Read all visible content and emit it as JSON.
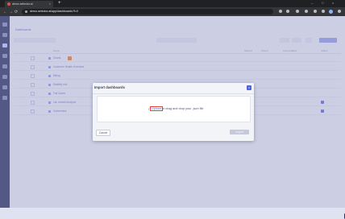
{
  "browser": {
    "tab_title": "demo.selector.ai",
    "url": "demo.selector.ai/app/dashboards?f=0",
    "new_tab_symbol": "+",
    "tab_close_symbol": "×",
    "nav": {
      "back": "←",
      "forward": "→",
      "reload": "⟳"
    },
    "window_controls": {
      "minimize": "–",
      "maximize": "□",
      "close": "×"
    }
  },
  "app": {
    "breadcrumb": "Dashboards",
    "sidebar_icons": [
      "home-icon",
      "chart-icon",
      "dashboard-icon",
      "bell-icon",
      "flow-icon",
      "list-icon",
      "settings-icon",
      "gear-icon"
    ],
    "active_sidebar_index": 2,
    "table": {
      "headers": [
        "Name",
        "Shared",
        "Owner",
        "Last updated",
        "Status"
      ],
      "rows": [
        {
          "name": "Charts",
          "tag": true,
          "dot": false
        },
        {
          "name": "Customer Health Overview",
          "tag": false,
          "dot": false
        },
        {
          "name": "Billing",
          "tag": false,
          "dot": false
        },
        {
          "name": "Stability Info",
          "tag": false,
          "dot": false
        },
        {
          "name": "Fail Cases",
          "tag": false,
          "dot": false
        },
        {
          "name": "Lat: overall Analysis",
          "tag": false,
          "dot": true
        },
        {
          "name": "Kubernetes",
          "tag": false,
          "dot": true
        }
      ]
    }
  },
  "modal": {
    "title": "Import dashboards",
    "close_symbol": "×",
    "upload_icon": "⇧",
    "upload_link": "Upload",
    "drop_text": "or drag and drop your .json file",
    "cancel_label": "Cancel",
    "import_label": "Import"
  },
  "colors": {
    "accent": "#5561d9",
    "sidebar": "#2b3160",
    "highlight_box": "#e0453a"
  }
}
